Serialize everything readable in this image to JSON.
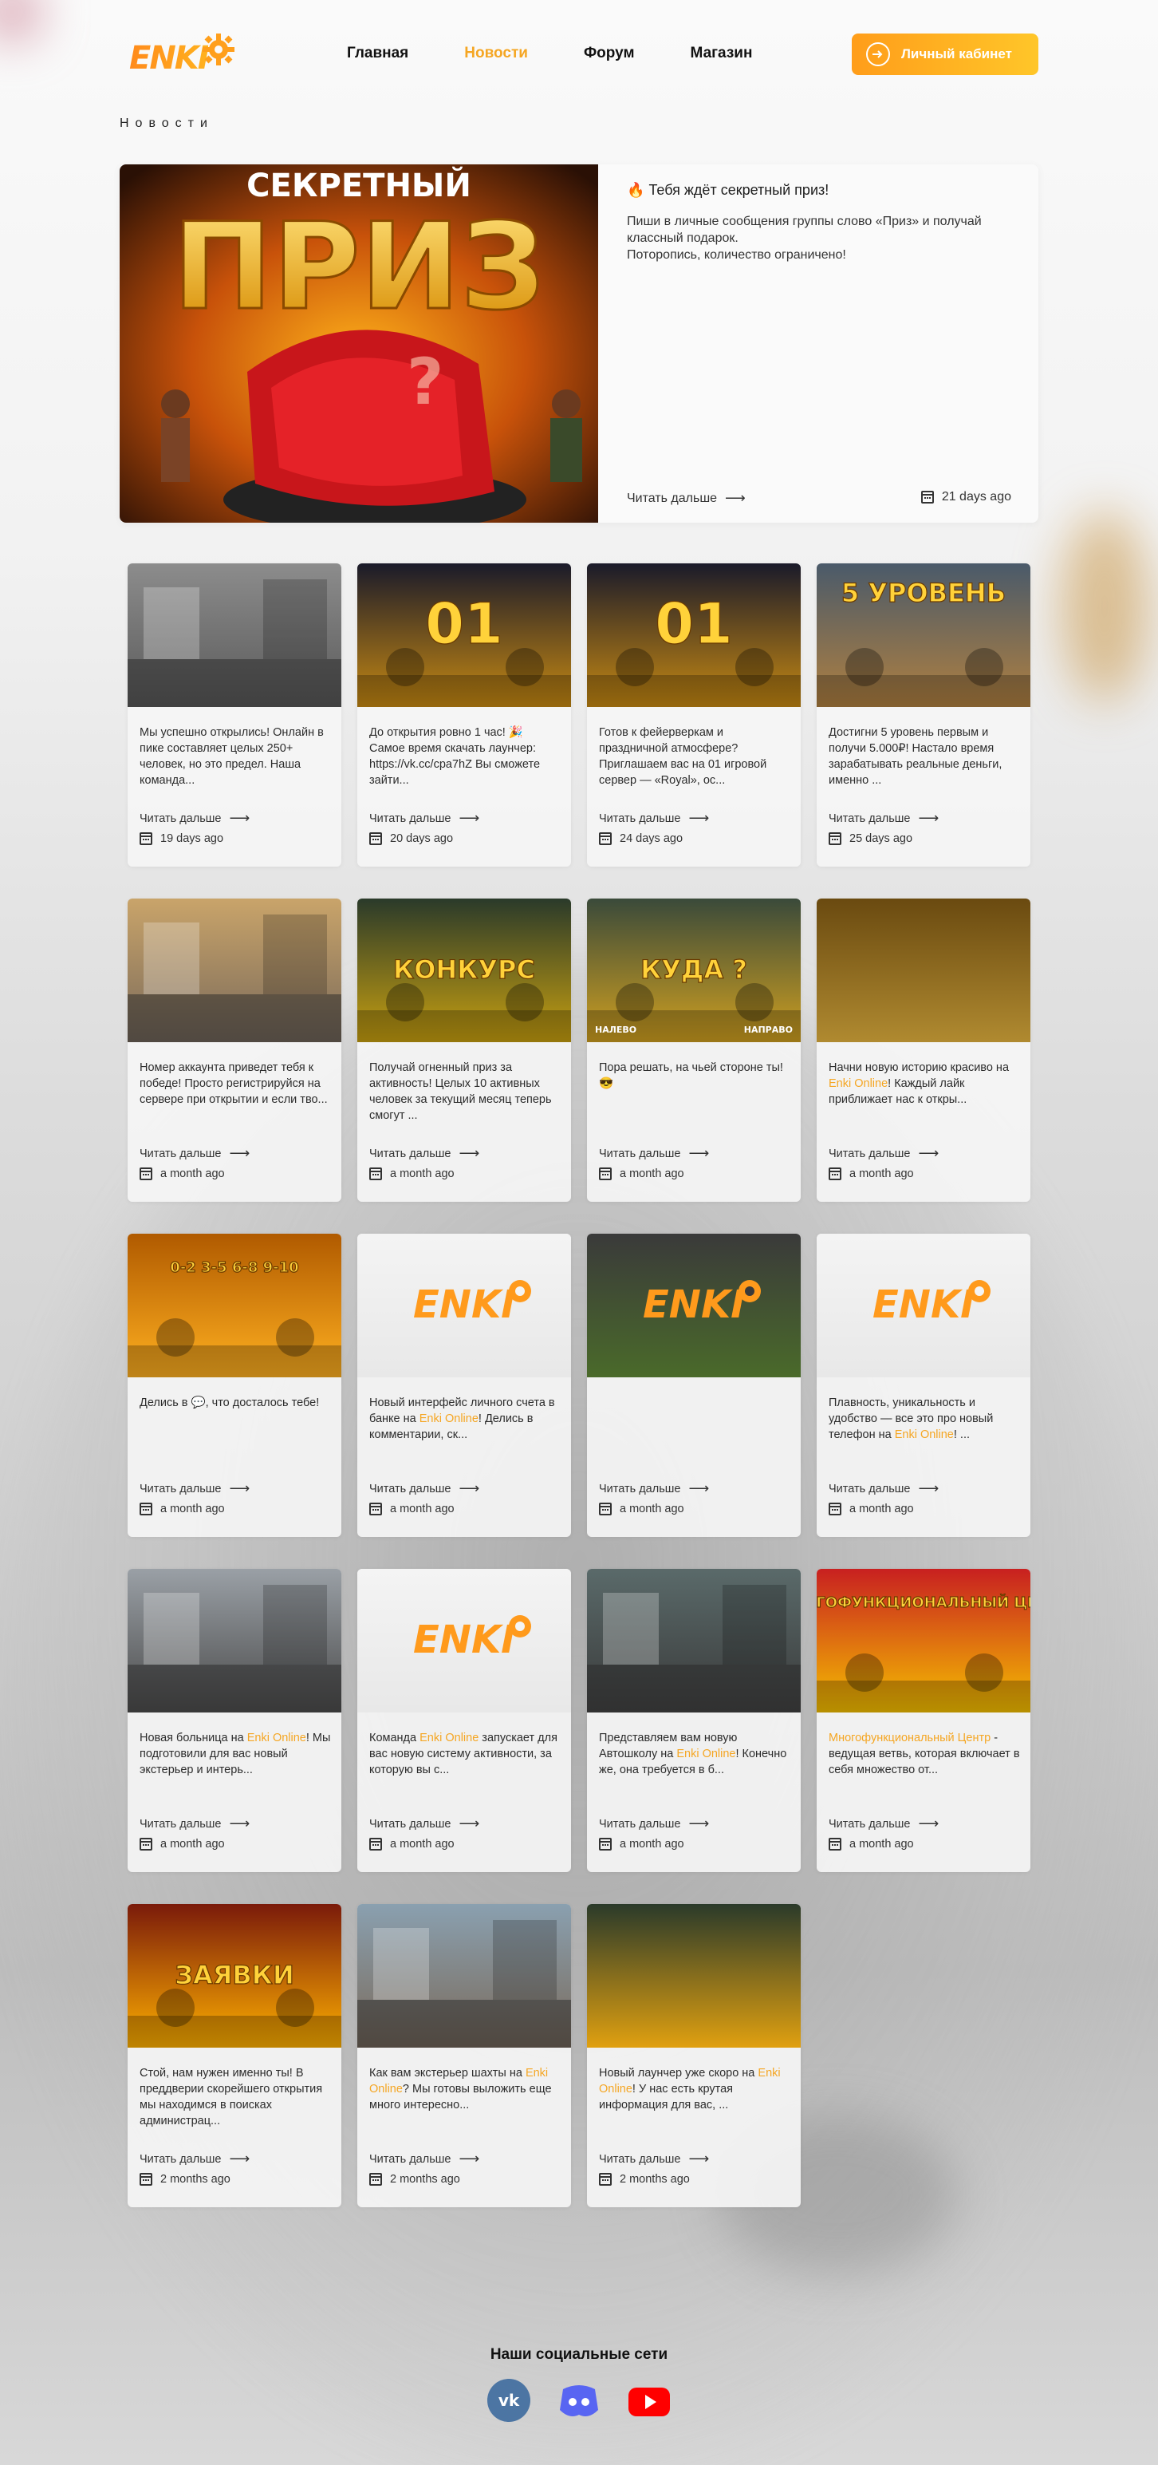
{
  "header": {
    "logo_text": "ENKI",
    "nav": [
      {
        "label": "Главная",
        "active": false
      },
      {
        "label": "Новости",
        "active": true
      },
      {
        "label": "Форум",
        "active": false
      },
      {
        "label": "Магазин",
        "active": false
      }
    ],
    "cabinet_label": "Личный кабинет"
  },
  "section_title": "Новости",
  "featured": {
    "headline": "Тебя ждёт секретный приз!",
    "text_line1": "Пиши в личные сообщения группы слово «Приз» и получай классный подарок.",
    "text_line2": "Потoропись, количество ограничено!",
    "read_more": "Читать дальше",
    "date": "21 days ago",
    "image_text_top": "СЕКРЕТНЫЙ",
    "image_text_main": "ПРИЗ"
  },
  "cards": [
    {
      "pre": "Мы успешно открылись! Онлайн в пике составляет целых 250+ человек, но это предел. Наша команда...",
      "read": "Читать дальше",
      "date": "19 days ago"
    },
    {
      "pre": "До открытия ровно 1 час! 🎉 Самое время скачать лаунчер: https://vk.cc/cpa7hZ Вы сможете зайти...",
      "read": "Читать дальше",
      "date": "20 days ago",
      "img_text": "01"
    },
    {
      "pre": "Готов к фейерверкам и праздничной атмосфере? Приглашаем вас на 01 игровой сервер — «Royal», ос...",
      "read": "Читать дальше",
      "date": "24 days ago",
      "img_text": "01"
    },
    {
      "pre": "Достигни 5 уровень первым и получи 5.000₽! Настало время зарабатывать реальные деньги, именно ...",
      "read": "Читать дальше",
      "date": "25 days ago",
      "img_text": "5 УРОВЕНЬ"
    },
    {
      "pre": "Номер аккаунта приведет тебя к победе! Просто регистрируйся на сервере при открытии и если тво...",
      "read": "Читать дальше",
      "date": "a month ago"
    },
    {
      "pre": "Получай огненный приз за активность! Целых 10 активных человек за текущий месяц теперь смогут ...",
      "read": "Читать дальше",
      "date": "a month ago",
      "img_text": "КОНКУРС"
    },
    {
      "pre": "Пора решать, на чьей стороне ты! 😎",
      "read": "Читать дальше",
      "date": "a month ago",
      "img_text": "КУДА ?",
      "img_left": "НАЛЕВО",
      "img_right": "НАПРАВО"
    },
    {
      "pre": "Начни новую историю красиво на ",
      "hl": "Enki Online",
      "post": "! Каждый лайк приближает нас к откры...",
      "read": "Читать дальше",
      "date": "a month ago"
    },
    {
      "pre": "Делись в 💬, что досталось тебе!",
      "read": "Читать дальше",
      "date": "a month ago",
      "img_text": "0-2  3-5  6-8  9-10"
    },
    {
      "pre": "Новый интерфейс личного счета в банке на ",
      "hl": "Enki Online",
      "post": "! Делись в комментарии, ск...",
      "read": "Читать дальше",
      "date": "a month ago"
    },
    {
      "pre": "",
      "read": "Читать дальше",
      "date": "a month ago"
    },
    {
      "pre": "Плавность, уникальность и удобство — все это про новый телефон на ",
      "hl": "Enki Online",
      "post": "! ...",
      "read": "Читать дальше",
      "date": "a month ago"
    },
    {
      "pre": "Новая больница на ",
      "hl": "Enki Online",
      "post": "! Мы подготовили для вас новый экстерьер и интерь...",
      "read": "Читать дальше",
      "date": "a month ago"
    },
    {
      "pre": "Команда ",
      "hl": "Enki Online",
      "post": " запускает для вас новую систему активности, за которую вы с...",
      "read": "Читать дальше",
      "date": "a month ago"
    },
    {
      "pre": "Представляем вам новую Автошколу на ",
      "hl": "Enki Online",
      "post": "! Конечно же, она требуется в б...",
      "read": "Читать дальше",
      "date": "a month ago"
    },
    {
      "pre": "",
      "hl": "Многофункциональный Центр",
      "post": " - ведущая ветвь, которая включает в себя множество от...",
      "read": "Читать дальше",
      "date": "a month ago",
      "img_text": "МНОГОФУНКЦИОНАЛЬНЫЙ ЦЕНТР"
    },
    {
      "pre": "Стой, нам нужен именно ты! В преддверии скорейшего открытия мы находимся в поисках администрац...",
      "read": "Читать дальше",
      "date": "2 months ago",
      "img_text": "ЗАЯВКИ"
    },
    {
      "pre": "Как вам экстерьер шахты на ",
      "hl": "Enki Online",
      "post": "? Мы готовы выложить еще много интересно...",
      "read": "Читать дальше",
      "date": "2 months ago"
    },
    {
      "pre": "Новый лаунчер уже скоро на ",
      "hl": "Enki Online",
      "post": "! У нас есть крутая информация для вас, ...",
      "read": "Читать дальше",
      "date": "2 months ago"
    }
  ],
  "social": {
    "title": "Наши социальные сети",
    "items": [
      {
        "icon": "vk-icon",
        "color": "#4c75a3"
      },
      {
        "icon": "discord-icon",
        "color": "#5865f2"
      },
      {
        "icon": "youtube-icon",
        "color": "#ff0000"
      }
    ]
  },
  "colors": {
    "accent": "#f5a623",
    "accent_gradient_from": "#ff9d1a",
    "accent_gradient_to": "#ffc629"
  }
}
